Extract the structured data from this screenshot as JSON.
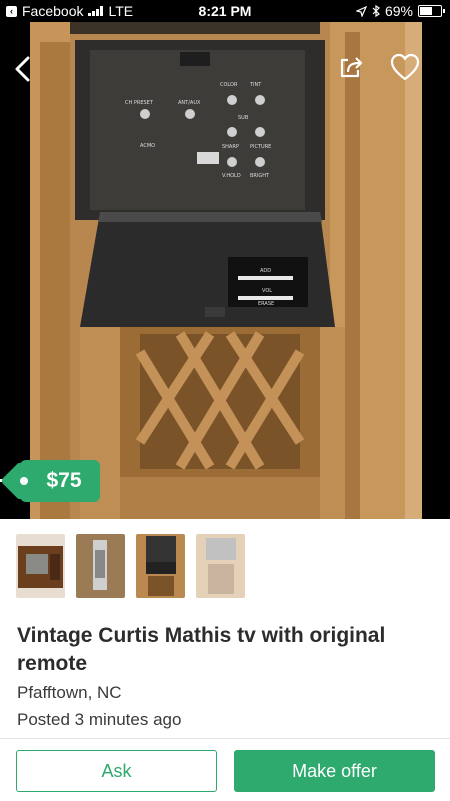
{
  "status_bar": {
    "back_app": "Facebook",
    "network": "LTE",
    "time": "8:21 PM",
    "battery": "69%",
    "battery_level": 0.69
  },
  "listing": {
    "price": "$75",
    "title": "Vintage Curtis Mathis tv with original remote",
    "location": "Pfafftown, NC",
    "posted": "Posted 3 minutes ago",
    "thumbnail_count": 4,
    "selected_thumbnail": 3
  },
  "actions": {
    "ask_label": "Ask",
    "offer_label": "Make offer"
  },
  "photo_panel_labels": {
    "color": "COLOR",
    "tint": "TINT",
    "ch_preset": "CH PRESET",
    "ant_aux": "ANT/AUX",
    "sub": "SUB",
    "sharp": "SHARP",
    "picture": "PICTURE",
    "acmo": "ACMO",
    "v_hold": "V.HOLD",
    "bright": "BRIGHT",
    "add": "ADD",
    "vol": "VOL",
    "erase": "ERASE"
  },
  "colors": {
    "accent": "#2eaa6e",
    "text": "#2c2c2c",
    "wood": "#b8874f"
  },
  "icons": {
    "back": "chevron-left-icon",
    "share": "share-icon",
    "favorite": "heart-outline-icon",
    "price_tag": "price-tag-icon"
  }
}
